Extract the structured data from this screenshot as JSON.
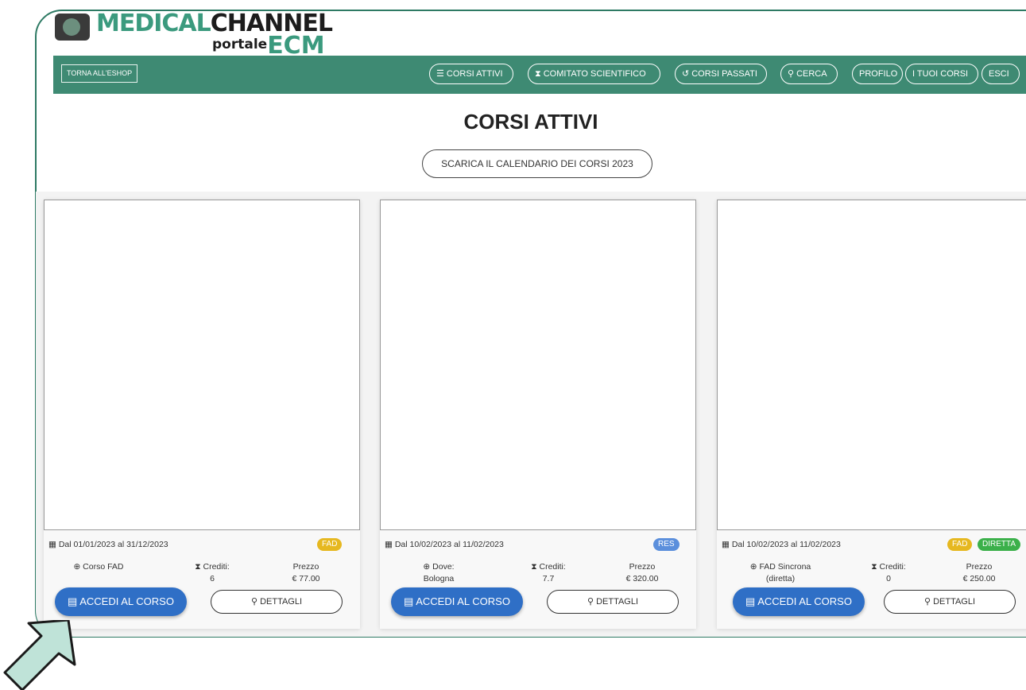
{
  "logo": {
    "word1": "MEDICAL",
    "word2": "CHANNEL",
    "sub1": "portale",
    "sub2": "ECM"
  },
  "nav": {
    "shop": "TORNA ALL'ESHOP",
    "corsi_attivi": "CORSI ATTIVI",
    "comitato": "COMITATO SCIENTIFICO",
    "corsi_passati": "CORSI PASSATI",
    "cerca": "CERCA",
    "profilo": "PROFILO",
    "tuoi_corsi": "I TUOI CORSI",
    "esci": "ESCI"
  },
  "page": {
    "title": "CORSI ATTIVI",
    "download": "SCARICA IL CALENDARIO DEI CORSI 2023"
  },
  "cards": [
    {
      "date": "Dal 01/01/2023 al 31/12/2023",
      "badge": "FAD",
      "where": "Corso FAD",
      "where2": "",
      "credits_label": "Crediti:",
      "credits": "6",
      "price_label": "Prezzo",
      "price": "€ 77.00",
      "access": "ACCEDI AL CORSO",
      "details": "DETTAGLI"
    },
    {
      "date": "Dal 10/02/2023 al 11/02/2023",
      "badge": "RES",
      "where": "Dove:",
      "where2": "Bologna",
      "credits_label": "Crediti:",
      "credits": "7.7",
      "price_label": "Prezzo",
      "price": "€ 320.00",
      "access": "ACCEDI AL CORSO",
      "details": "DETTAGLI"
    },
    {
      "date": "Dal 10/02/2023 al 11/02/2023",
      "badge": "FAD",
      "badge2": "DIRETTA",
      "where": "FAD Sincrona",
      "where2": "(diretta)",
      "credits_label": "Crediti:",
      "credits": "0",
      "price_label": "Prezzo",
      "price": "€ 250.00",
      "access": "ACCEDI AL CORSO",
      "details": "DETTAGLI"
    }
  ],
  "colors": {
    "brand": "#3e8a73",
    "accent_blue": "#2f6fc6",
    "badge_fad": "#e6b820",
    "badge_res": "#5b8fdc",
    "badge_diretta": "#3bb04a",
    "arrow": "#bfe3d8"
  }
}
